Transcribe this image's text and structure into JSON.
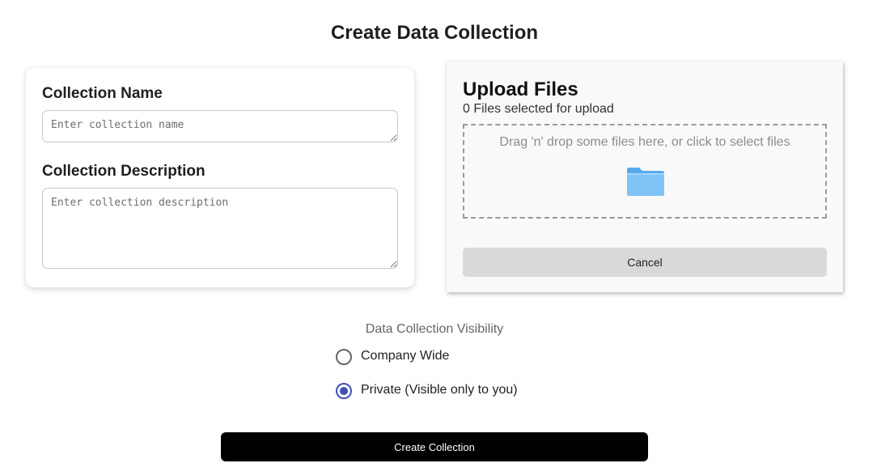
{
  "page": {
    "title": "Create Data Collection"
  },
  "form": {
    "name_label": "Collection Name",
    "name_placeholder": "Enter collection name",
    "name_value": "",
    "description_label": "Collection Description",
    "description_placeholder": "Enter collection description",
    "description_value": ""
  },
  "upload": {
    "title": "Upload Files",
    "count_text": "0 Files selected for upload",
    "dropzone_text": "Drag 'n' drop some files here, or click to select files",
    "dropzone_icon": "folder-icon",
    "cancel_label": "Cancel"
  },
  "visibility": {
    "heading": "Data Collection Visibility",
    "options": [
      {
        "label": "Company Wide",
        "selected": false
      },
      {
        "label": "Private (Visible only to you)",
        "selected": true
      }
    ]
  },
  "actions": {
    "create_label": "Create Collection"
  },
  "colors": {
    "accent": "#3f51b5",
    "primary_button": "#000000",
    "cancel_button": "#d9d9d9",
    "folder": "#7fc3f7"
  }
}
